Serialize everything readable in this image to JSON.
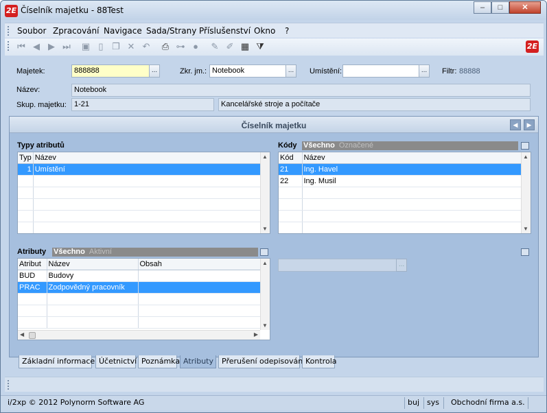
{
  "window": {
    "title": "Číselník majetku - 88Test",
    "app_icon": "2E",
    "min": "–",
    "max": "□",
    "close": "✕"
  },
  "menu": [
    "Soubor",
    "Zpracování",
    "Navigace",
    "Sada/Strany",
    "Příslušenství",
    "Okno",
    "?"
  ],
  "toolbar": {
    "icons": [
      "first-icon",
      "prev-icon",
      "next-icon",
      "last-icon",
      "save-icon",
      "new-icon",
      "copy-icon",
      "delete-icon",
      "undo-icon",
      "print-icon",
      "tree-icon",
      "disabled-icon",
      "edit-icon",
      "erase-icon",
      "excel-icon",
      "filter-icon"
    ],
    "logo": "2E"
  },
  "form": {
    "majetek_label": "Majetek:",
    "majetek_value": "888888",
    "zkr_label": "Zkr. jm.:",
    "zkr_value": "Notebook",
    "umisteni_label": "Umístění:",
    "umisteni_value": "",
    "filtr_label": "Filtr:",
    "filtr_value": "88888",
    "nazev_label": "Název:",
    "nazev_value": "Notebook",
    "skup_label": "Skup. majetku:",
    "skup_code": "1-21",
    "skup_name": "Kancelářské stroje a počítače",
    "ellipsis": "..."
  },
  "panel": {
    "title": "Číselník majetku",
    "typy": {
      "heading": "Typy atributů",
      "cols": [
        "Typ",
        "Název"
      ],
      "rows": [
        [
          "1",
          "Umístění"
        ]
      ]
    },
    "kody": {
      "heading": "Kódy",
      "filter_on": "Všechno",
      "filter_off": "Označené",
      "cols": [
        "Kód",
        "Název"
      ],
      "rows": [
        [
          "21",
          "Ing. Havel"
        ],
        [
          "22",
          "Ing. Musil"
        ]
      ]
    },
    "atributy": {
      "heading": "Atributy",
      "filter_on": "Všechno",
      "filter_off": "Aktivní",
      "cols": [
        "Atribut",
        "Název",
        "Obsah"
      ],
      "rows": [
        [
          "BUD",
          "Budovy",
          ""
        ],
        [
          "PRAC",
          "Zodpovědný pracovník",
          ""
        ]
      ]
    }
  },
  "tabs": [
    "Základní informace",
    "Účetnictví",
    "Poznámka",
    "Atributy",
    "Přerušení odepisování",
    "Kontrola"
  ],
  "active_tab": "Atributy",
  "status": {
    "copyright": "i/2xp © 2012 Polynorm Software AG",
    "user": "buj",
    "db": "sys",
    "company": "Obchodní firma a.s."
  },
  "colors": {
    "selection": "#3399ff",
    "logo_red": "#d42020",
    "panel": "#a6bfde"
  }
}
